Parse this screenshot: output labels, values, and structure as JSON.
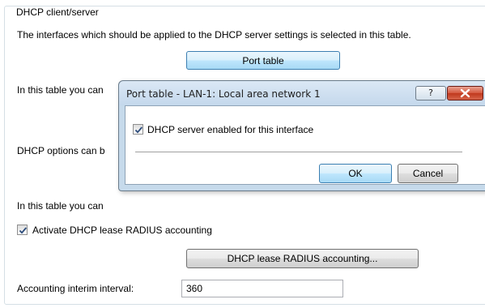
{
  "group": {
    "legend": "DHCP client/server",
    "intro_text": "The interfaces which should be applied to the DHCP server settings is selected in this table.",
    "port_table_button": "Port table",
    "line2_text": "In this table you can",
    "line3_text": "DHCP options can b",
    "line4_text": "In this table you can",
    "activate_accounting_label": "Activate DHCP lease RADIUS accounting",
    "activate_accounting_checked": true,
    "accounting_button": "DHCP lease RADIUS accounting...",
    "interim_label": "Accounting interim interval:",
    "interim_value": "360"
  },
  "dialog": {
    "title": "Port table - LAN-1: Local area network 1",
    "help_label": "?",
    "close_icon": "close-x-icon",
    "enable_label": "DHCP server enabled for this interface",
    "enable_checked": true,
    "ok_label": "OK",
    "cancel_label": "Cancel"
  },
  "colors": {
    "hot_button": "#bee6fd",
    "close_button": "#c0381d",
    "check_mark": "#2a4a7a"
  }
}
